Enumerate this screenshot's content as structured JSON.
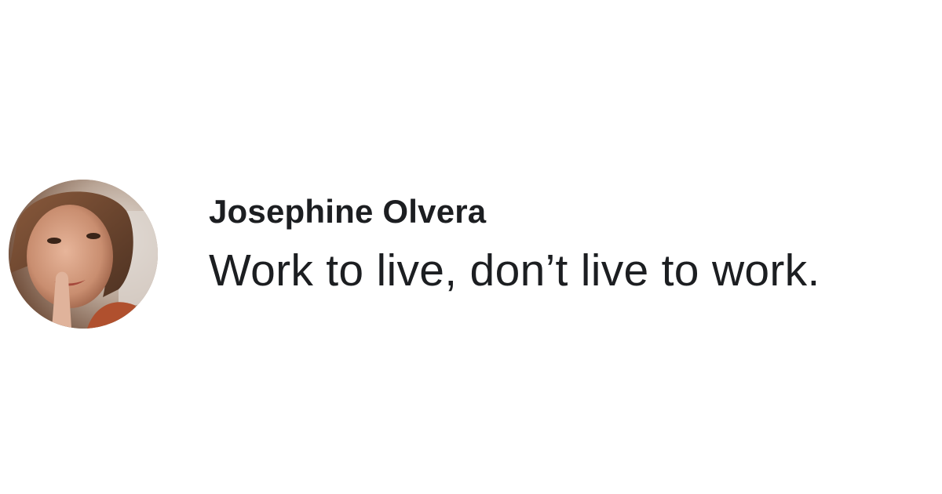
{
  "comment": {
    "author_name": "Josephine Olvera",
    "text": "Work to live, don’t live to work.",
    "avatar_icon": "profile-photo"
  },
  "colors": {
    "text": "#1c1e21",
    "background": "#ffffff"
  }
}
